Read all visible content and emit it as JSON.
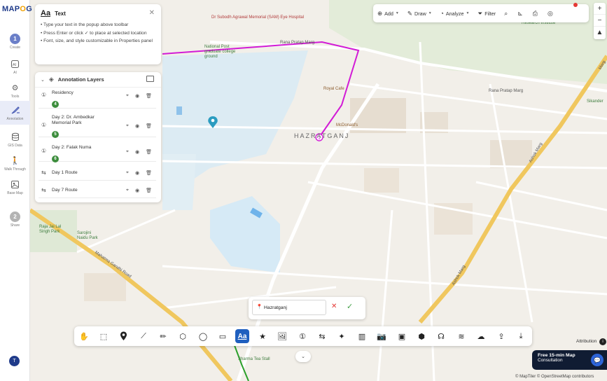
{
  "brand": {
    "logo_main": "MAP",
    "logo_accent": "O",
    "logo_tail": "G"
  },
  "rail": {
    "items": [
      {
        "key": "create",
        "label": "Create",
        "badge": "1",
        "icon": "step-number"
      },
      {
        "key": "ai",
        "label": "AI",
        "icon": "ai-icon"
      },
      {
        "key": "tools",
        "label": "Tools",
        "icon": "gear-icon"
      },
      {
        "key": "annotation",
        "label": "Annotation",
        "icon": "annotation-brush-icon"
      },
      {
        "key": "gis",
        "label": "GIS Data",
        "icon": "database-icon"
      },
      {
        "key": "walk",
        "label": "Walk Through",
        "icon": "walk-icon"
      },
      {
        "key": "base",
        "label": "Base Map",
        "icon": "basemap-icon"
      },
      {
        "key": "share",
        "label": "Share",
        "badge": "2",
        "icon": "step-number"
      }
    ],
    "avatar": "T"
  },
  "text_panel": {
    "icon": "Aa",
    "title": "Text",
    "tips": [
      "• Type your text in the popup above toolbar",
      "• Press Enter or click ✓ to place at selected location",
      "• Font, size, and style customizable in Properties panel"
    ]
  },
  "layers_panel": {
    "title": "Annotation Layers",
    "rows": [
      {
        "name": "Residency",
        "badge": "4",
        "kind": "point"
      },
      {
        "name": "Day 2: Dr. Ambedkar Memorial Park",
        "badge": "5",
        "kind": "point"
      },
      {
        "name": "Day 2: Falak Numa",
        "badge": "6",
        "kind": "point"
      },
      {
        "name": "Day 1 Route",
        "kind": "route"
      },
      {
        "name": "Day 7 Route",
        "kind": "route"
      }
    ]
  },
  "top_toolbar": {
    "add": "Add",
    "draw": "Draw",
    "analyze": "Analyze",
    "filter": "Filter"
  },
  "text_input": {
    "value": "Hazratganj"
  },
  "map_labels": {
    "hospital": "Dr Subodh Agrawal Memorial (SAM) Eye Hospital",
    "college": "National Post graduate college ground",
    "research": "Research Institute",
    "rana_pratap_1": "Rana Pratap Marg",
    "rana_pratap_2": "Rana Pratap Marg",
    "royal_cafe": "Royal Cafe",
    "mcdonalds": "McDonald's",
    "hazratganj": "HAZRATGANJ",
    "sikander": "Sikander",
    "ashok_marg_1": "Ashok Marg",
    "ashok_marg_2": "Ashok Marg",
    "raja_jai_lal": "Raja Jai Lal Singh Park",
    "sarojini": "Sarojini Naidu Park",
    "mg_marg": "Mahatma Gandhi Road",
    "tea_stall": "Sharma Tea Stall",
    "marg_right": "Marg"
  },
  "consult": {
    "line1": "Free 15-min Map",
    "line2": "Consultation"
  },
  "attribution": "Attribution",
  "credits": "© MapTiler © OpenStreetMap contributors",
  "colors": {
    "accent": "#1f5fbf",
    "route_pink": "#d21bd6",
    "route_green": "#2aa02a",
    "major_road": "#f0c75e"
  }
}
